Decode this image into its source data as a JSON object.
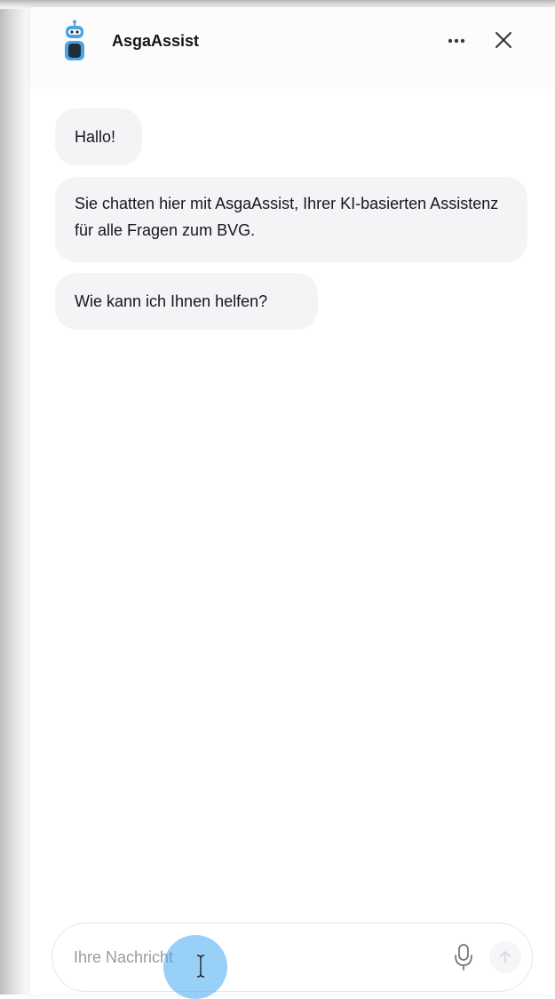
{
  "header": {
    "title": "AsgaAssist",
    "menu_icon": "more-horizontal-icon",
    "close_icon": "close-icon",
    "bot_icon": "robot-icon"
  },
  "messages": [
    {
      "text": "Hallo!"
    },
    {
      "text": "Sie chatten hier mit AsgaAssist, Ihrer KI-basierten Assistenz für alle Fragen zum BVG."
    },
    {
      "text": "Wie kann ich Ihnen helfen?"
    }
  ],
  "composer": {
    "placeholder": "Ihre Nachricht",
    "mic_icon": "microphone-icon",
    "send_icon": "arrow-up-icon"
  },
  "colors": {
    "accent": "#4aa6e0",
    "bubble": "#f4f4f7"
  }
}
